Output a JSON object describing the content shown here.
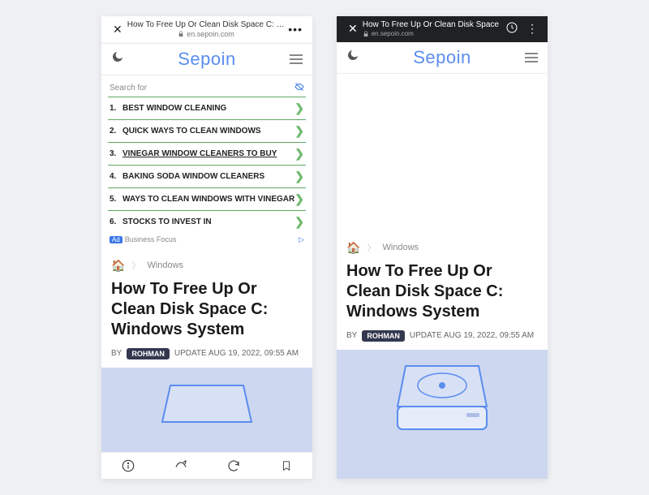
{
  "left": {
    "addr": {
      "title": "How To Free Up Or Clean Disk Space C: Window...",
      "url": "en.sepoin.com"
    },
    "brand": "Sepoin",
    "ad": {
      "heading": "Search for",
      "items": [
        {
          "n": "1.",
          "t": "BEST WINDOW CLEANING"
        },
        {
          "n": "2.",
          "t": "QUICK WAYS TO CLEAN WINDOWS"
        },
        {
          "n": "3.",
          "t": "VINEGAR WINDOW CLEANERS TO BUY"
        },
        {
          "n": "4.",
          "t": "BAKING SODA WINDOW CLEANERS"
        },
        {
          "n": "5.",
          "t": "WAYS TO CLEAN WINDOWS WITH VINEGAR"
        },
        {
          "n": "6.",
          "t": "STOCKS TO INVEST IN"
        }
      ],
      "foot_pill": "Ad",
      "foot_text": "Business Focus"
    },
    "crumb": "Windows",
    "title": "How To Free Up Or Clean Disk Space C: Windows System",
    "by": "BY",
    "author": "ROHMAN",
    "update": "UPDATE AUG 19, 2022, 09:55 AM"
  },
  "right": {
    "addr": {
      "title": "How To Free Up Or Clean Disk Space",
      "url": "en.sepoin.com"
    },
    "brand": "Sepoin",
    "crumb": "Windows",
    "title": "How To Free Up Or Clean Disk Space C: Windows System",
    "by": "BY",
    "author": "ROHMAN",
    "update": "UPDATE AUG 19, 2022, 09:55 AM"
  }
}
